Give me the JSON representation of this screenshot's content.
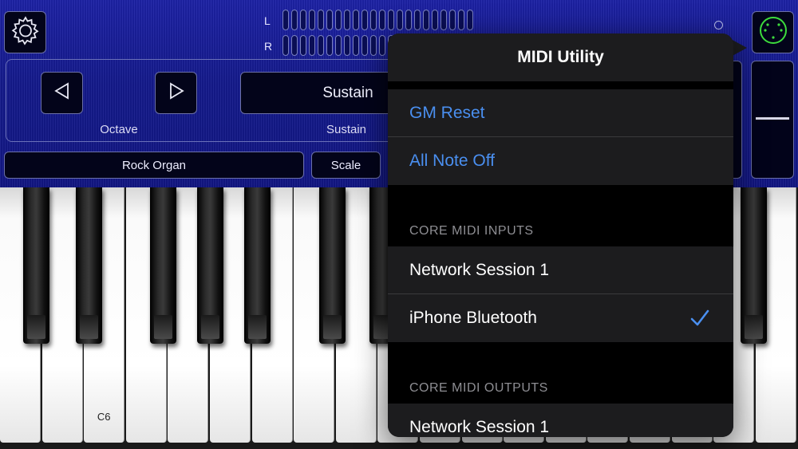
{
  "meters": {
    "left_label": "L",
    "right_label": "R",
    "segments": 22
  },
  "controls": {
    "octave_caption": "Octave",
    "sustain_button": "Sustain",
    "sustain_caption": "Sustain",
    "preset": "Rock Organ",
    "scale": "Scale"
  },
  "keyboard": {
    "c_label": "C6"
  },
  "popover": {
    "title": "MIDI Utility",
    "actions": [
      "GM Reset",
      "All Note Off"
    ],
    "inputs_header": "CORE MIDI INPUTS",
    "inputs": [
      {
        "label": "Network Session 1",
        "checked": false
      },
      {
        "label": "iPhone Bluetooth",
        "checked": true
      }
    ],
    "outputs_header": "CORE MIDI OUTPUTS",
    "outputs": [
      {
        "label": "Network Session 1",
        "checked": false
      }
    ]
  },
  "colors": {
    "accent_blue": "#4a8ff0",
    "panel_blue": "#1a1f9e",
    "midi_green": "#3ddc3d"
  },
  "icons": {
    "settings": "gear-icon",
    "midi": "midi-connector-icon",
    "octave_down": "triangle-left-icon",
    "octave_up": "triangle-right-icon",
    "selected": "checkmark-icon"
  }
}
